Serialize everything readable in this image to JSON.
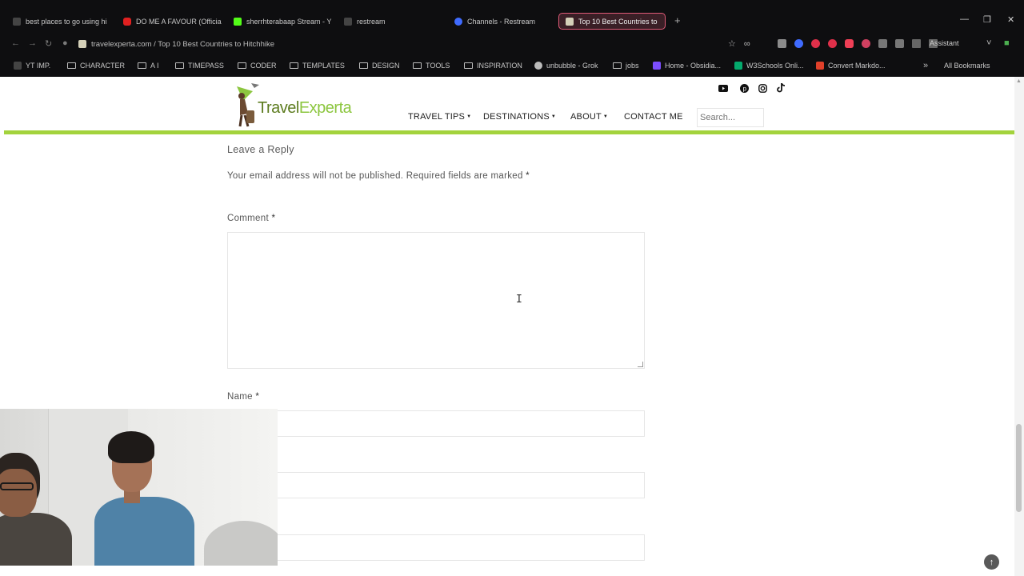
{
  "browser": {
    "tabs": [
      {
        "title": "best places to go using hi",
        "color": "#444444"
      },
      {
        "title": "DO ME A FAVOUR (Officia",
        "color": "#e02020"
      },
      {
        "title": "sherrhterabaap Stream - Y",
        "color": "#53fc18"
      },
      {
        "title": "restream",
        "color": "#444444"
      },
      {
        "title": "Channels - Restream",
        "color": "#3f6bff"
      },
      {
        "title": "Top 10 Best Countries to",
        "color": "#d4d0b8"
      }
    ],
    "url": "travelexperta.com / Top 10 Best Countries to Hitchhike",
    "assistant_label": "Assistant",
    "bookmarks": [
      {
        "label": "YT IMP."
      },
      {
        "label": "CHARACTER"
      },
      {
        "label": "A I"
      },
      {
        "label": "TIMEPASS"
      },
      {
        "label": "CODER"
      },
      {
        "label": "TEMPLATES"
      },
      {
        "label": "DESIGN"
      },
      {
        "label": "TOOLS"
      },
      {
        "label": "INSPIRATION"
      },
      {
        "label": "unbubble - Grok"
      },
      {
        "label": "jobs"
      },
      {
        "label": "Home - Obsidia..."
      },
      {
        "label": "W3Schools Onli..."
      },
      {
        "label": "Convert Markdo..."
      }
    ],
    "all_bookmarks": "All Bookmarks"
  },
  "site": {
    "logo": {
      "part1": "Travel",
      "part2": "Experta"
    },
    "nav": {
      "travel_tips": "TRAVEL TIPS",
      "destinations": "DESTINATIONS",
      "about": "ABOUT",
      "contact": "CONTACT ME"
    },
    "search_placeholder": "Search...",
    "social_icons": [
      "youtube-icon",
      "pinterest-icon",
      "instagram-icon",
      "tiktok-icon"
    ],
    "accent_color": "#a3d33d"
  },
  "form": {
    "title": "Leave a Reply",
    "notes": "Your email address will not be published. Required fields are marked",
    "required_mark": "*",
    "comment_label": "Comment",
    "name_label": "Name"
  }
}
